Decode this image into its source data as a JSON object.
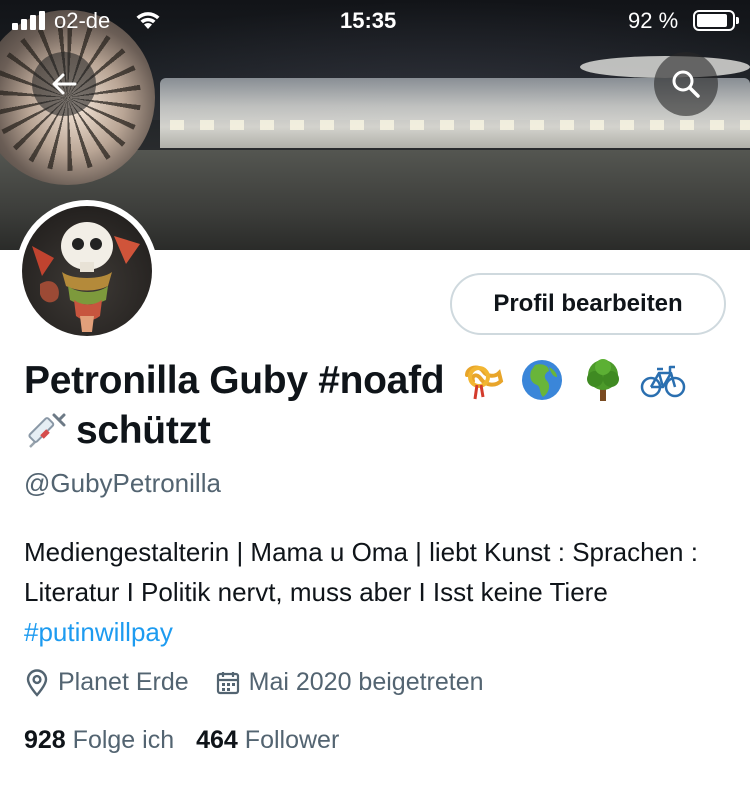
{
  "status_bar": {
    "carrier": "o2-de",
    "time": "15:35",
    "battery": "92 %"
  },
  "profile": {
    "edit_button_label": "Profil bearbeiten",
    "display_name": "Petronilla Guby #noafd",
    "display_name_line2": "schützt",
    "name_emojis": [
      "postal-horn-icon",
      "globe-africa-europe-icon",
      "deciduous-tree-icon",
      "bicycle-icon",
      "syringe-icon"
    ],
    "handle": "@GubyPetronilla",
    "bio_text": "Mediengestalterin | Mama u Oma | liebt Kunst : Sprachen : Literatur I Politik nervt, muss aber I Isst keine Tiere",
    "bio_hashtag": "#putinwillpay",
    "location": "Planet Erde",
    "joined": "Mai 2020 beigetreten",
    "following_count": "928",
    "following_label": "Folge ich",
    "followers_count": "464",
    "followers_label": "Follower"
  },
  "colors": {
    "link": "#1d9bf0",
    "secondary_text": "#536471",
    "primary_text": "#0f1419",
    "button_border": "#cfd9de"
  }
}
